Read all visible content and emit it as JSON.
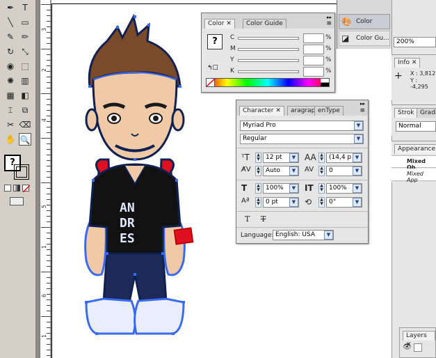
{
  "toolbox": {
    "tools": [
      {
        "name": "pen-tool",
        "glyph": "✒"
      },
      {
        "name": "type-tool",
        "glyph": "T"
      },
      {
        "name": "line-tool",
        "glyph": "╲"
      },
      {
        "name": "rectangle-tool",
        "glyph": "▭"
      },
      {
        "name": "paintbrush-tool",
        "glyph": "✎"
      },
      {
        "name": "pencil-tool",
        "glyph": "✏"
      },
      {
        "name": "rotate-tool",
        "glyph": "↻"
      },
      {
        "name": "scale-tool",
        "glyph": "⤡"
      },
      {
        "name": "warp-tool",
        "glyph": "◉"
      },
      {
        "name": "free-transform-tool",
        "glyph": "⬚"
      },
      {
        "name": "symbol-sprayer-tool",
        "glyph": "✺"
      },
      {
        "name": "column-graph-tool",
        "glyph": "▥"
      },
      {
        "name": "mesh-tool",
        "glyph": "▦"
      },
      {
        "name": "gradient-tool",
        "glyph": "◧"
      },
      {
        "name": "eyedropper-tool",
        "glyph": "⌶"
      },
      {
        "name": "blend-tool",
        "glyph": "⧉"
      },
      {
        "name": "slice-tool",
        "glyph": "✂"
      },
      {
        "name": "eraser-tool",
        "glyph": "⌫"
      },
      {
        "name": "hand-tool",
        "glyph": "✋"
      },
      {
        "name": "zoom-tool",
        "glyph": "🔍"
      }
    ],
    "fill_stroke_glyph": "?"
  },
  "ruler": {
    "labels": [
      "3",
      "2",
      "4",
      "5",
      "1",
      "6",
      "1"
    ]
  },
  "color_panel": {
    "tabs": [
      "Color",
      "Color Guide"
    ],
    "channels": [
      {
        "label": "C",
        "value": "",
        "unit": "%"
      },
      {
        "label": "M",
        "value": "",
        "unit": "%"
      },
      {
        "label": "Y",
        "value": "",
        "unit": "%"
      },
      {
        "label": "K",
        "value": "",
        "unit": "%"
      }
    ],
    "swatch_glyph": "?"
  },
  "dock_buttons": [
    {
      "label": "Color"
    },
    {
      "label": "Color Gu..."
    }
  ],
  "character_panel": {
    "tabs": [
      "Character",
      "aragraph",
      "enType"
    ],
    "font_family": "Myriad Pro",
    "font_style": "Regular",
    "font_size": "12 pt",
    "leading": "(14,4 p",
    "kerning": "Auto",
    "tracking": "0",
    "horizontal_scale": "100%",
    "vertical_scale": "100%",
    "baseline_shift": "0 pt",
    "rotation": "0°",
    "language_label": "Language:",
    "language": "English: USA"
  },
  "right_dock": {
    "zoom": "200%",
    "info_tab": "Info",
    "info_x": "X : 3,812",
    "info_y": "Y : -4,295",
    "stroke_tabs": [
      "Strok",
      "Gradie"
    ],
    "blend_mode": "Normal",
    "appearance_tab": "Appearance",
    "appearance_items": [
      "Mixed Ob",
      "Mixed App"
    ],
    "layers_tab": "Layers"
  },
  "artwork": {
    "shirt_text": [
      "AN",
      "DR",
      "ES"
    ],
    "colors": {
      "outline": "#102050",
      "skin": "#f0c9a6",
      "hair": "#7a4a2a",
      "shirt": "#111111",
      "backpack": "#e01020",
      "jeans": "#1c2a5a",
      "selection": "#3a6af0"
    }
  }
}
